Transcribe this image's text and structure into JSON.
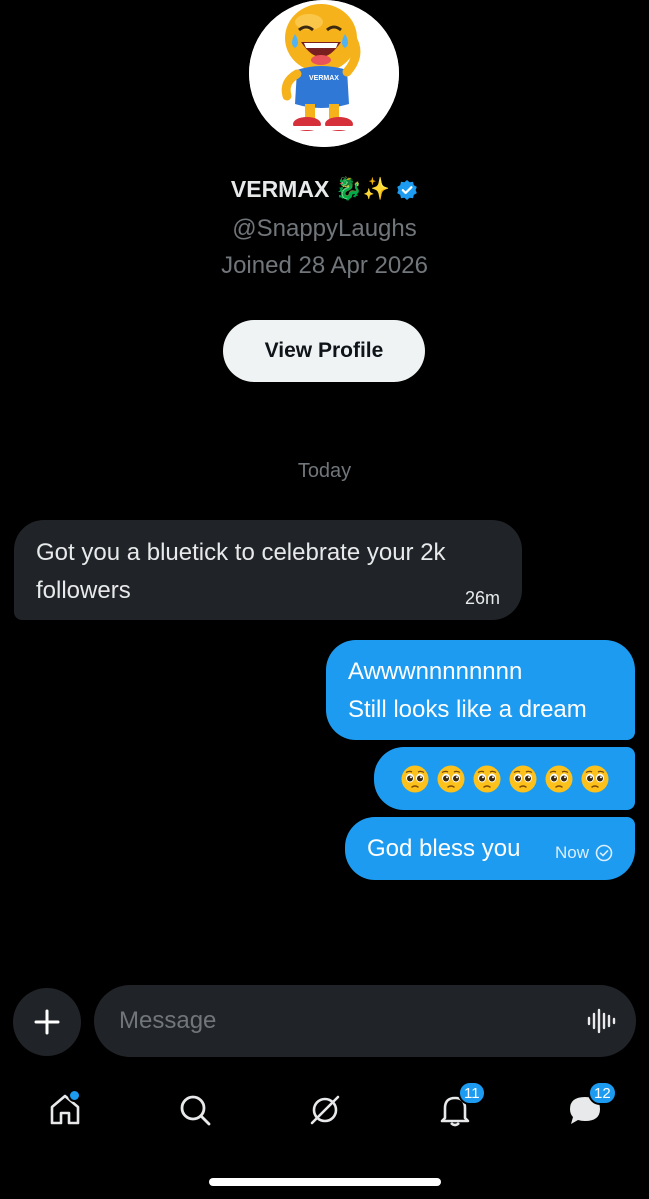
{
  "profile": {
    "display_name": "VERMAX",
    "name_emojis": "🐉✨",
    "handle": "@SnappyLaughs",
    "joined": "Joined 28 Apr 2026",
    "view_profile_label": "View Profile",
    "avatar_shirt_text": "VERMAX"
  },
  "chat": {
    "date_separator": "Today",
    "messages": [
      {
        "direction": "incoming",
        "text": "Got you a bluetick to celebrate your 2k followers",
        "time": "26m"
      },
      {
        "direction": "outgoing",
        "text": "Awwwnnnnnnnn\nStill looks like a dream"
      },
      {
        "direction": "outgoing",
        "emoji_count": 6,
        "emoji_name": "pleading-face"
      },
      {
        "direction": "outgoing",
        "text": "God bless you",
        "time": "Now",
        "status": "sent"
      }
    ]
  },
  "composer": {
    "placeholder": "Message"
  },
  "nav": {
    "home_has_dot": true,
    "notifications_badge": "11",
    "messages_badge": "12"
  },
  "colors": {
    "background": "#000000",
    "accent": "#1d9bf0",
    "incoming_bubble": "#202327"
  }
}
